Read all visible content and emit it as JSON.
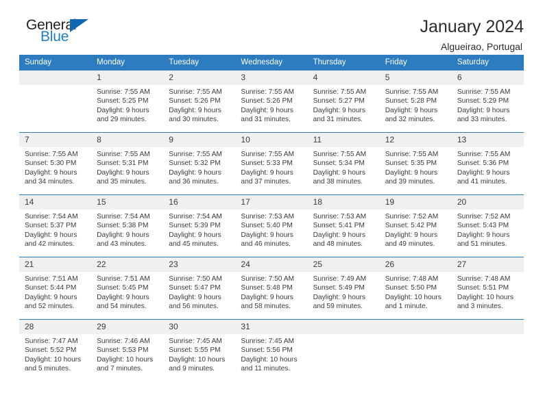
{
  "brand": {
    "word_one": "General",
    "word_two": "Blue",
    "mark": "triangle-logo"
  },
  "header": {
    "title": "January 2024",
    "subtitle": "Algueirao, Portugal"
  },
  "theme": {
    "accent": "#2e7cc0",
    "brand_blue": "#1167b1",
    "daynum_band": "#f0f0f0",
    "text": "#3a3a3a"
  },
  "calendar": {
    "weekdays": [
      "Sunday",
      "Monday",
      "Tuesday",
      "Wednesday",
      "Thursday",
      "Friday",
      "Saturday"
    ],
    "labels": {
      "sunrise": "Sunrise:",
      "sunset": "Sunset:",
      "daylight": "Daylight:"
    },
    "weeks": [
      [
        {
          "day": "",
          "sunrise": "",
          "sunset": "",
          "daylight_line1": "",
          "daylight_line2": ""
        },
        {
          "day": "1",
          "sunrise": "Sunrise: 7:55 AM",
          "sunset": "Sunset: 5:25 PM",
          "daylight_line1": "Daylight: 9 hours",
          "daylight_line2": "and 29 minutes."
        },
        {
          "day": "2",
          "sunrise": "Sunrise: 7:55 AM",
          "sunset": "Sunset: 5:26 PM",
          "daylight_line1": "Daylight: 9 hours",
          "daylight_line2": "and 30 minutes."
        },
        {
          "day": "3",
          "sunrise": "Sunrise: 7:55 AM",
          "sunset": "Sunset: 5:26 PM",
          "daylight_line1": "Daylight: 9 hours",
          "daylight_line2": "and 31 minutes."
        },
        {
          "day": "4",
          "sunrise": "Sunrise: 7:55 AM",
          "sunset": "Sunset: 5:27 PM",
          "daylight_line1": "Daylight: 9 hours",
          "daylight_line2": "and 31 minutes."
        },
        {
          "day": "5",
          "sunrise": "Sunrise: 7:55 AM",
          "sunset": "Sunset: 5:28 PM",
          "daylight_line1": "Daylight: 9 hours",
          "daylight_line2": "and 32 minutes."
        },
        {
          "day": "6",
          "sunrise": "Sunrise: 7:55 AM",
          "sunset": "Sunset: 5:29 PM",
          "daylight_line1": "Daylight: 9 hours",
          "daylight_line2": "and 33 minutes."
        }
      ],
      [
        {
          "day": "7",
          "sunrise": "Sunrise: 7:55 AM",
          "sunset": "Sunset: 5:30 PM",
          "daylight_line1": "Daylight: 9 hours",
          "daylight_line2": "and 34 minutes."
        },
        {
          "day": "8",
          "sunrise": "Sunrise: 7:55 AM",
          "sunset": "Sunset: 5:31 PM",
          "daylight_line1": "Daylight: 9 hours",
          "daylight_line2": "and 35 minutes."
        },
        {
          "day": "9",
          "sunrise": "Sunrise: 7:55 AM",
          "sunset": "Sunset: 5:32 PM",
          "daylight_line1": "Daylight: 9 hours",
          "daylight_line2": "and 36 minutes."
        },
        {
          "day": "10",
          "sunrise": "Sunrise: 7:55 AM",
          "sunset": "Sunset: 5:33 PM",
          "daylight_line1": "Daylight: 9 hours",
          "daylight_line2": "and 37 minutes."
        },
        {
          "day": "11",
          "sunrise": "Sunrise: 7:55 AM",
          "sunset": "Sunset: 5:34 PM",
          "daylight_line1": "Daylight: 9 hours",
          "daylight_line2": "and 38 minutes."
        },
        {
          "day": "12",
          "sunrise": "Sunrise: 7:55 AM",
          "sunset": "Sunset: 5:35 PM",
          "daylight_line1": "Daylight: 9 hours",
          "daylight_line2": "and 39 minutes."
        },
        {
          "day": "13",
          "sunrise": "Sunrise: 7:55 AM",
          "sunset": "Sunset: 5:36 PM",
          "daylight_line1": "Daylight: 9 hours",
          "daylight_line2": "and 41 minutes."
        }
      ],
      [
        {
          "day": "14",
          "sunrise": "Sunrise: 7:54 AM",
          "sunset": "Sunset: 5:37 PM",
          "daylight_line1": "Daylight: 9 hours",
          "daylight_line2": "and 42 minutes."
        },
        {
          "day": "15",
          "sunrise": "Sunrise: 7:54 AM",
          "sunset": "Sunset: 5:38 PM",
          "daylight_line1": "Daylight: 9 hours",
          "daylight_line2": "and 43 minutes."
        },
        {
          "day": "16",
          "sunrise": "Sunrise: 7:54 AM",
          "sunset": "Sunset: 5:39 PM",
          "daylight_line1": "Daylight: 9 hours",
          "daylight_line2": "and 45 minutes."
        },
        {
          "day": "17",
          "sunrise": "Sunrise: 7:53 AM",
          "sunset": "Sunset: 5:40 PM",
          "daylight_line1": "Daylight: 9 hours",
          "daylight_line2": "and 46 minutes."
        },
        {
          "day": "18",
          "sunrise": "Sunrise: 7:53 AM",
          "sunset": "Sunset: 5:41 PM",
          "daylight_line1": "Daylight: 9 hours",
          "daylight_line2": "and 48 minutes."
        },
        {
          "day": "19",
          "sunrise": "Sunrise: 7:52 AM",
          "sunset": "Sunset: 5:42 PM",
          "daylight_line1": "Daylight: 9 hours",
          "daylight_line2": "and 49 minutes."
        },
        {
          "day": "20",
          "sunrise": "Sunrise: 7:52 AM",
          "sunset": "Sunset: 5:43 PM",
          "daylight_line1": "Daylight: 9 hours",
          "daylight_line2": "and 51 minutes."
        }
      ],
      [
        {
          "day": "21",
          "sunrise": "Sunrise: 7:51 AM",
          "sunset": "Sunset: 5:44 PM",
          "daylight_line1": "Daylight: 9 hours",
          "daylight_line2": "and 52 minutes."
        },
        {
          "day": "22",
          "sunrise": "Sunrise: 7:51 AM",
          "sunset": "Sunset: 5:45 PM",
          "daylight_line1": "Daylight: 9 hours",
          "daylight_line2": "and 54 minutes."
        },
        {
          "day": "23",
          "sunrise": "Sunrise: 7:50 AM",
          "sunset": "Sunset: 5:47 PM",
          "daylight_line1": "Daylight: 9 hours",
          "daylight_line2": "and 56 minutes."
        },
        {
          "day": "24",
          "sunrise": "Sunrise: 7:50 AM",
          "sunset": "Sunset: 5:48 PM",
          "daylight_line1": "Daylight: 9 hours",
          "daylight_line2": "and 58 minutes."
        },
        {
          "day": "25",
          "sunrise": "Sunrise: 7:49 AM",
          "sunset": "Sunset: 5:49 PM",
          "daylight_line1": "Daylight: 9 hours",
          "daylight_line2": "and 59 minutes."
        },
        {
          "day": "26",
          "sunrise": "Sunrise: 7:48 AM",
          "sunset": "Sunset: 5:50 PM",
          "daylight_line1": "Daylight: 10 hours",
          "daylight_line2": "and 1 minute."
        },
        {
          "day": "27",
          "sunrise": "Sunrise: 7:48 AM",
          "sunset": "Sunset: 5:51 PM",
          "daylight_line1": "Daylight: 10 hours",
          "daylight_line2": "and 3 minutes."
        }
      ],
      [
        {
          "day": "28",
          "sunrise": "Sunrise: 7:47 AM",
          "sunset": "Sunset: 5:52 PM",
          "daylight_line1": "Daylight: 10 hours",
          "daylight_line2": "and 5 minutes."
        },
        {
          "day": "29",
          "sunrise": "Sunrise: 7:46 AM",
          "sunset": "Sunset: 5:53 PM",
          "daylight_line1": "Daylight: 10 hours",
          "daylight_line2": "and 7 minutes."
        },
        {
          "day": "30",
          "sunrise": "Sunrise: 7:45 AM",
          "sunset": "Sunset: 5:55 PM",
          "daylight_line1": "Daylight: 10 hours",
          "daylight_line2": "and 9 minutes."
        },
        {
          "day": "31",
          "sunrise": "Sunrise: 7:45 AM",
          "sunset": "Sunset: 5:56 PM",
          "daylight_line1": "Daylight: 10 hours",
          "daylight_line2": "and 11 minutes."
        },
        {
          "day": "",
          "sunrise": "",
          "sunset": "",
          "daylight_line1": "",
          "daylight_line2": ""
        },
        {
          "day": "",
          "sunrise": "",
          "sunset": "",
          "daylight_line1": "",
          "daylight_line2": ""
        },
        {
          "day": "",
          "sunrise": "",
          "sunset": "",
          "daylight_line1": "",
          "daylight_line2": ""
        }
      ]
    ]
  }
}
